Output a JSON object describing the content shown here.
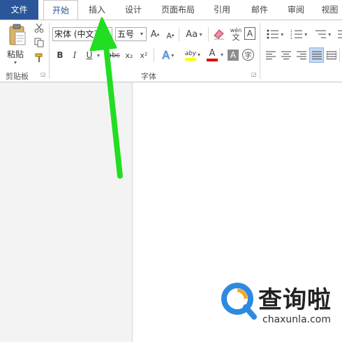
{
  "tabs": {
    "file": "文件",
    "home": "开始",
    "insert": "插入",
    "design": "设计",
    "layout": "页面布局",
    "references": "引用",
    "mailings": "邮件",
    "review": "审阅",
    "view": "视图"
  },
  "clipboard": {
    "paste_label": "粘贴",
    "group_label": "剪贴板"
  },
  "font": {
    "font_name": "宋体 (中文正",
    "font_size": "五号",
    "group_label": "字体",
    "grow": "A",
    "shrink": "A",
    "change_case": "Aa",
    "bold": "B",
    "italic": "I",
    "underline": "U",
    "strikethrough": "abc",
    "subscript": "x₂",
    "superscript": "x²",
    "phonetic_top": "wén",
    "phonetic_bottom": "文",
    "char_border": "A",
    "text_effects": "A",
    "highlight": "aby",
    "font_color": "A",
    "char_shading": "A",
    "enclose": "字"
  },
  "watermark": {
    "brand": "查询啦",
    "url": "chaxunla.com"
  },
  "colors": {
    "file_tab": "#2b579a",
    "arrow": "#22dd22",
    "highlight_yellow": "#ffff00",
    "font_red": "#e00000",
    "logo_blue": "#2d8ae0",
    "logo_orange": "#f5a623"
  }
}
